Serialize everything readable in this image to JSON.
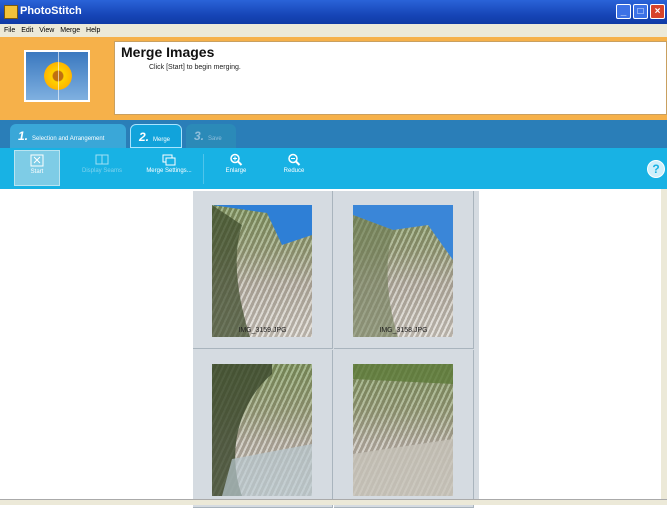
{
  "window": {
    "title": "PhotoStitch"
  },
  "menu": [
    "File",
    "Edit",
    "View",
    "Merge",
    "Help"
  ],
  "header": {
    "title": "Merge Images",
    "subtitle": "Click [Start] to begin merging."
  },
  "tabs": [
    {
      "num": "1.",
      "label": "Selection and Arrangement"
    },
    {
      "num": "2.",
      "label": "Merge"
    },
    {
      "num": "3.",
      "label": "Save"
    }
  ],
  "toolbar": {
    "start": "Start",
    "display_seams": "Display Seams",
    "merge_settings": "Merge Settings...",
    "enlarge": "Enlarge",
    "reduce": "Reduce",
    "help": "?"
  },
  "images": [
    {
      "filename": "IMG_3159.JPG"
    },
    {
      "filename": "IMG_3158.JPG"
    },
    {
      "filename": ""
    },
    {
      "filename": ""
    }
  ]
}
